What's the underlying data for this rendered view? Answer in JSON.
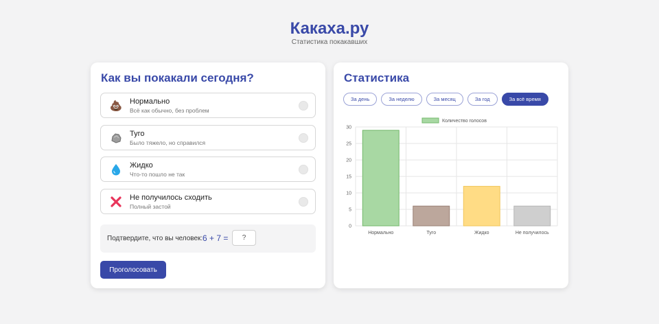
{
  "header": {
    "title": "Какаха.ру",
    "subtitle": "Статистика покакавших"
  },
  "vote": {
    "title": "Как вы покакали сегодня?",
    "options": [
      {
        "icon": "poop-icon",
        "glyph": "💩",
        "label": "Нормально",
        "desc": "Всё как обычно, без проблем"
      },
      {
        "icon": "rock-icon",
        "glyph": "🪨",
        "label": "Туго",
        "desc": "Было тяжело, но справился"
      },
      {
        "icon": "droplet-icon",
        "glyph": "💧",
        "label": "Жидко",
        "desc": "Что-то пошло не так"
      },
      {
        "icon": "cross-icon",
        "glyph": "❌",
        "label": "Не получилось сходить",
        "desc": "Полный застой"
      }
    ],
    "captcha_label": "Подтвердите, что вы человек:",
    "captcha_expr": "6 + 7 =",
    "captcha_placeholder": "?",
    "captcha_value": "",
    "submit_label": "Проголосовать"
  },
  "stats": {
    "title": "Статистика",
    "periods": [
      {
        "label": "За день",
        "active": false
      },
      {
        "label": "За неделю",
        "active": false
      },
      {
        "label": "За месяц",
        "active": false
      },
      {
        "label": "За год",
        "active": false
      },
      {
        "label": "За всё время",
        "active": true
      }
    ]
  },
  "colors": {
    "accent": "#3949a8",
    "bar_fills": [
      "#a8d8a3",
      "#bca79c",
      "#ffdc85",
      "#cfcfcf"
    ],
    "bar_strokes": [
      "#74b86c",
      "#9a8074",
      "#f1c65a",
      "#b5b5b5"
    ]
  },
  "chart_data": {
    "type": "bar",
    "categories": [
      "Нормально",
      "Туго",
      "Жидко",
      "Не получилось"
    ],
    "series": [
      {
        "name": "Количество голосов",
        "values": [
          29,
          6,
          12,
          6
        ]
      }
    ],
    "ylim": [
      0,
      30
    ],
    "yticks": [
      0,
      5,
      10,
      15,
      20,
      25,
      30
    ],
    "grid": true,
    "legend": "top-center"
  }
}
